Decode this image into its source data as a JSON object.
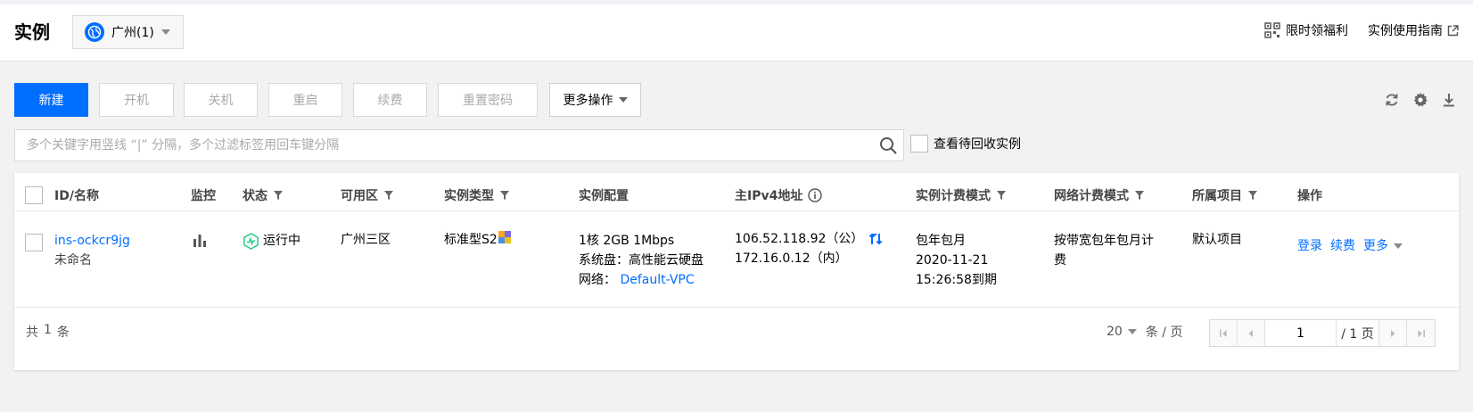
{
  "header": {
    "title": "实例",
    "region": "广州(1)",
    "benefit_link": "限时领福利",
    "guide_link": "实例使用指南"
  },
  "toolbar": {
    "create": "新建",
    "start": "开机",
    "shutdown": "关机",
    "restart": "重启",
    "renew": "续费",
    "reset_password": "重置密码",
    "more_actions": "更多操作"
  },
  "search": {
    "placeholder": "多个关键字用竖线 “|” 分隔，多个过滤标签用回车键分隔",
    "recycle_label": "查看待回收实例"
  },
  "table": {
    "columns": {
      "id_name": "ID/名称",
      "monitor": "监控",
      "status": "状态",
      "zone": "可用区",
      "type": "实例类型",
      "config": "实例配置",
      "ipv4": "主IPv4地址",
      "billing": "实例计费模式",
      "net_billing": "网络计费模式",
      "project": "所属项目",
      "ops": "操作"
    },
    "rows": [
      {
        "id": "ins-ockcr9jg",
        "name": "未命名",
        "status": "运行中",
        "zone": "广州三区",
        "type": "标准型S2",
        "config_line1": "1核 2GB 1Mbps",
        "config_line2": "系统盘：高性能云硬盘",
        "network_label": "网络：",
        "network_value": "Default-VPC",
        "ip_public": "106.52.118.92（公）",
        "ip_private": "172.16.0.12（内）",
        "billing_line1": "包年包月",
        "billing_line2": "2020-11-21",
        "billing_line3": "15:26:58到期",
        "net_billing_line1": "按带宽包年包月计",
        "net_billing_line2": "费",
        "project": "默认项目",
        "op_login": "登录",
        "op_renew": "续费",
        "op_more": "更多"
      }
    ]
  },
  "footer": {
    "total_prefix": "共",
    "total_count": "1",
    "total_suffix": "条",
    "page_size": "20",
    "page_size_unit": "条 / 页",
    "current_page": "1",
    "total_pages": "/ 1 页"
  },
  "colors": {
    "primary": "#006eff",
    "running": "#29cc85"
  }
}
